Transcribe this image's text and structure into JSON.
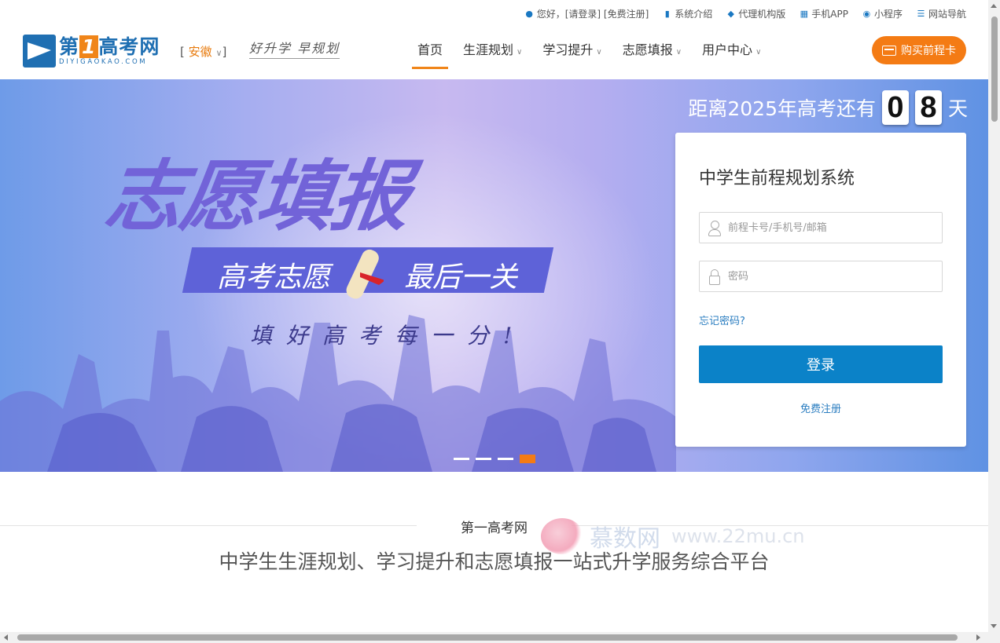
{
  "topbar": {
    "links": [
      {
        "icon": "user-icon",
        "label": "您好，[请登录] [免费注册]"
      },
      {
        "icon": "document-icon",
        "label": "系统介绍"
      },
      {
        "icon": "diamond-icon",
        "label": "代理机构版"
      },
      {
        "icon": "grid-icon",
        "label": "手机APP"
      },
      {
        "icon": "miniprogram-icon",
        "label": "小程序"
      },
      {
        "icon": "menu-icon",
        "label": "网站导航"
      }
    ]
  },
  "header": {
    "logo_name_prefix": "第",
    "logo_name_num": "1",
    "logo_name_suffix": "高考网",
    "logo_sub": "DIYIGAOKAO.COM",
    "province_open": "[",
    "province": "安徽",
    "province_close": "]",
    "slogan": "好升学 早规划",
    "nav": [
      {
        "label": "首页",
        "active": true
      },
      {
        "label": "生涯规划",
        "dropdown": true
      },
      {
        "label": "学习提升",
        "dropdown": true
      },
      {
        "label": "志愿填报",
        "dropdown": true
      },
      {
        "label": "用户中心",
        "dropdown": true
      }
    ],
    "buy_label": "购买前程卡"
  },
  "banner": {
    "headline": "志愿填报",
    "ribbon_left": "高考志愿",
    "ribbon_right": "最后一关",
    "tagline": "填好高考每一分!",
    "countdown_prefix": "距离2025年高考还有",
    "countdown_digits": [
      "0",
      "8"
    ],
    "countdown_suffix": "天",
    "slides_total": 4,
    "slide_active": 4
  },
  "login": {
    "title": "中学生前程规划系统",
    "username_placeholder": "前程卡号/手机号/邮箱",
    "password_placeholder": "密码",
    "forgot": "忘记密码?",
    "submit": "登录",
    "register": "免费注册"
  },
  "section": {
    "title": "第一高考网",
    "subtitle": "中学生生涯规划、学习提升和志愿填报一站式升学服务综合平台"
  },
  "watermark": {
    "text": "慕数网",
    "url": "www.22mu.cn"
  },
  "colors": {
    "accent": "#f47b14",
    "brand": "#1f6fb2",
    "primary_button": "#0b82c8"
  }
}
